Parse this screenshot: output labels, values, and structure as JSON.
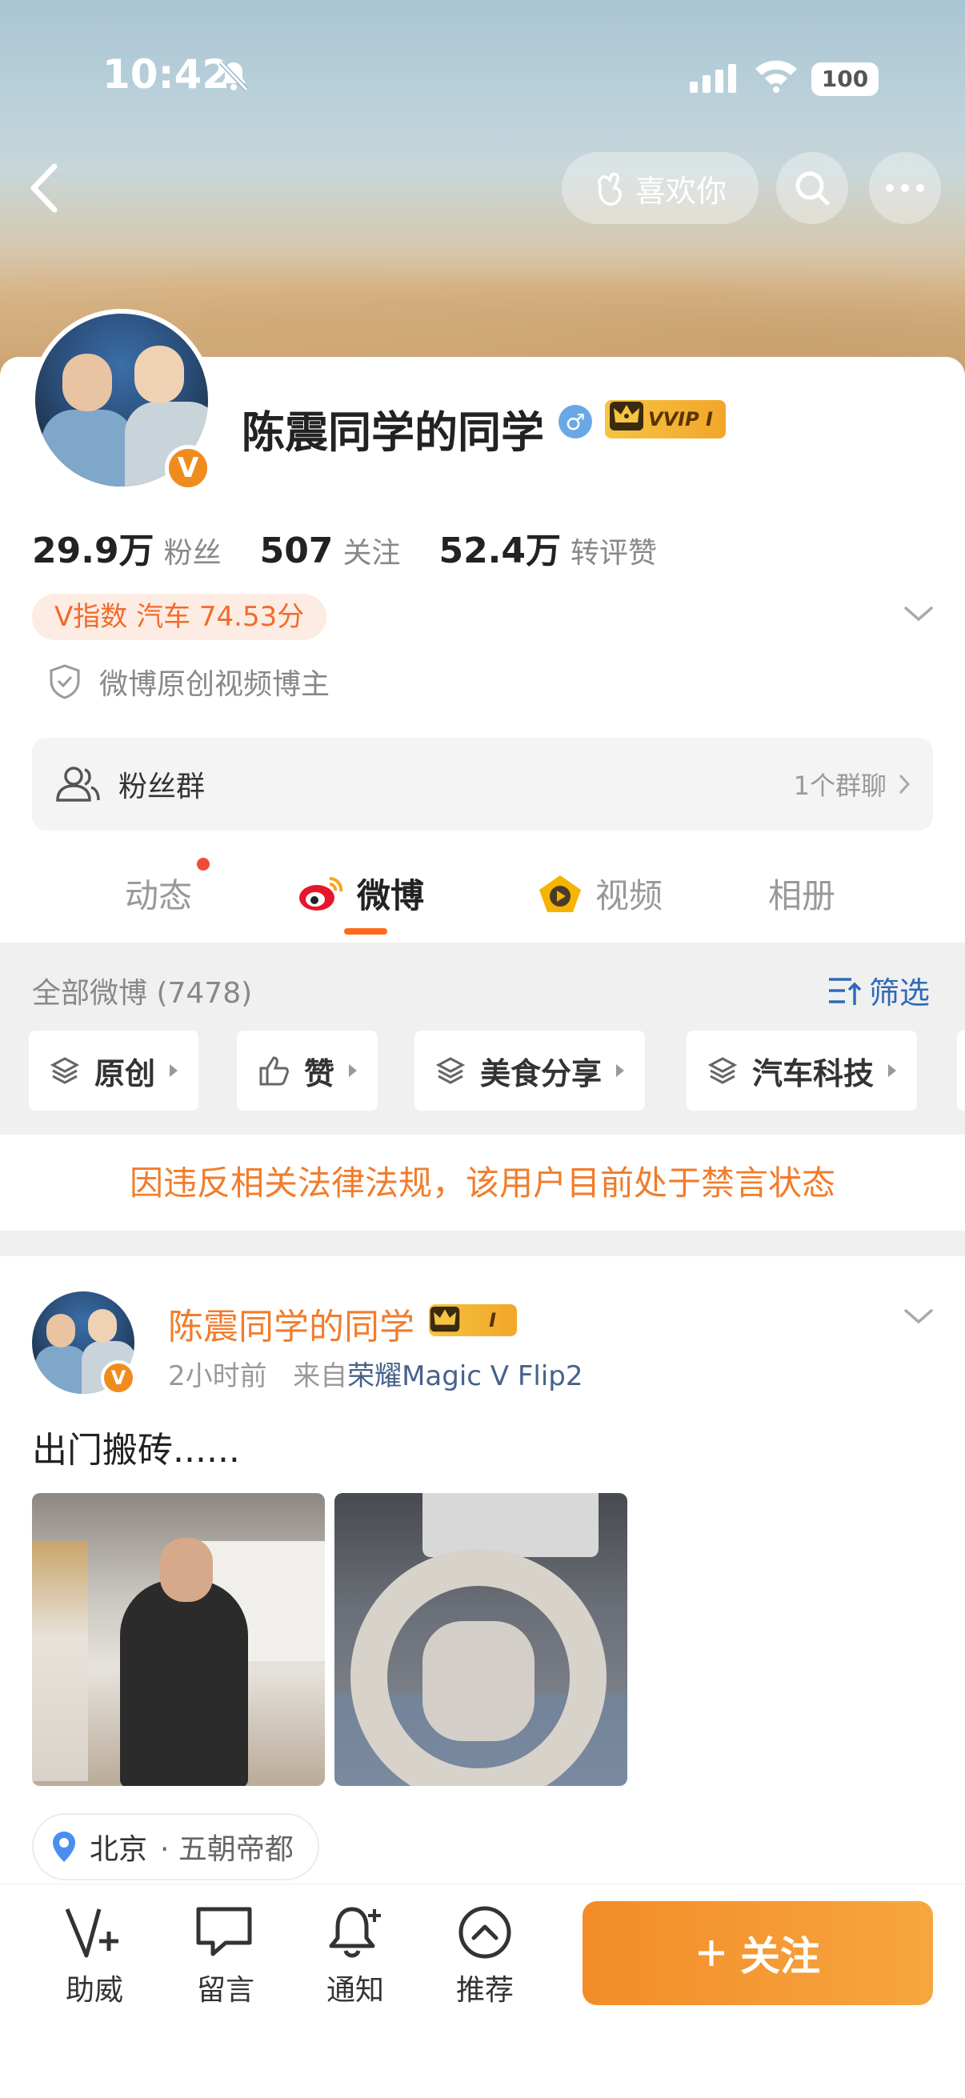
{
  "status_bar": {
    "time": "10:42",
    "battery": "100"
  },
  "header": {
    "like_button": "喜欢你"
  },
  "profile": {
    "name": "陈震同学的同学",
    "vip_label": "VVIP I",
    "badge": "V",
    "stats": [
      {
        "value": "29.9万",
        "label": "粉丝"
      },
      {
        "value": "507",
        "label": "关注"
      },
      {
        "value": "52.4万",
        "label": "转评赞"
      }
    ],
    "v_index": "V指数 汽车 74.53分",
    "verification": "微博原创视频博主"
  },
  "fans_group": {
    "label": "粉丝群",
    "count": "1个群聊"
  },
  "tabs": [
    {
      "label": "动态"
    },
    {
      "label": "微博"
    },
    {
      "label": "视频"
    },
    {
      "label": "相册"
    }
  ],
  "filter": {
    "all_label": "全部微博 (7478)",
    "filter_label": "筛选",
    "chips": [
      "原创",
      "赞",
      "美食分享",
      "汽车科技"
    ]
  },
  "banned_notice": "因违反相关法律法规，该用户目前处于禁言状态",
  "post": {
    "author": "陈震同学的同学",
    "vip_label": "I",
    "time": "2小时前",
    "source_prefix": "来自",
    "device": "荣耀Magic V Flip2",
    "text": "出门搬砖......",
    "location_city": "北京",
    "location_sub": "· 五朝帝都"
  },
  "bottom_bar": {
    "items": [
      "助威",
      "留言",
      "通知",
      "推荐"
    ],
    "follow": "关注"
  },
  "colors": {
    "accent": "#f27c2b",
    "link": "#2e6bb7",
    "follow": "#f38c28"
  }
}
